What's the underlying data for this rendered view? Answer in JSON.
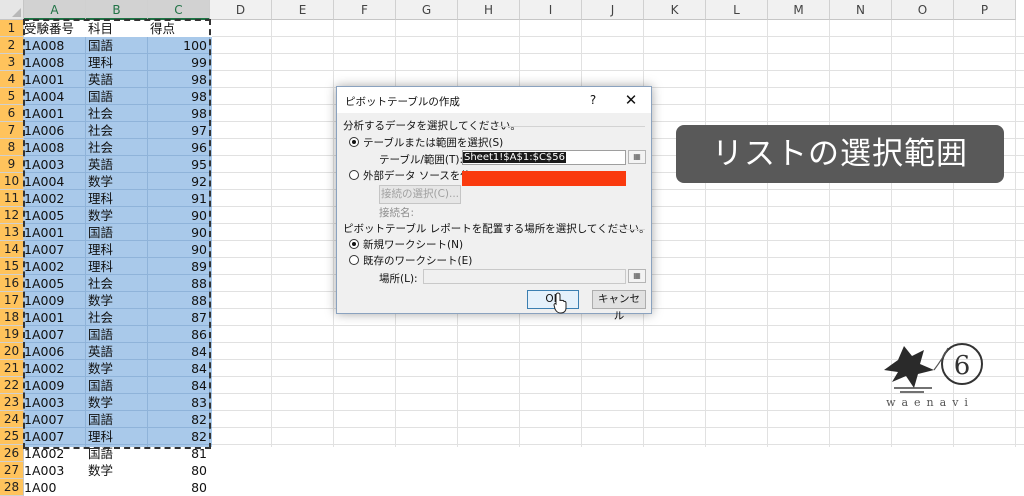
{
  "spreadsheet": {
    "columns": [
      "A",
      "B",
      "C",
      "D",
      "E",
      "F",
      "G",
      "H",
      "I",
      "J",
      "K",
      "L",
      "M",
      "N",
      "O",
      "P"
    ],
    "rows": [
      "1",
      "2",
      "3",
      "4",
      "5",
      "6",
      "7",
      "8",
      "9",
      "10",
      "11",
      "12",
      "13",
      "14",
      "15",
      "16",
      "17",
      "18",
      "19",
      "20",
      "21",
      "22",
      "23",
      "24",
      "25",
      "26",
      "27",
      "28"
    ],
    "header": [
      "受験番号",
      "科目",
      "得点"
    ],
    "data": [
      [
        "1A008",
        "国語",
        "100"
      ],
      [
        "1A008",
        "理科",
        "99"
      ],
      [
        "1A001",
        "英語",
        "98"
      ],
      [
        "1A004",
        "国語",
        "98"
      ],
      [
        "1A001",
        "社会",
        "98"
      ],
      [
        "1A006",
        "社会",
        "97"
      ],
      [
        "1A008",
        "社会",
        "96"
      ],
      [
        "1A003",
        "英語",
        "95"
      ],
      [
        "1A004",
        "数学",
        "92"
      ],
      [
        "1A002",
        "理科",
        "91"
      ],
      [
        "1A005",
        "数学",
        "90"
      ],
      [
        "1A001",
        "国語",
        "90"
      ],
      [
        "1A007",
        "理科",
        "90"
      ],
      [
        "1A002",
        "理科",
        "89"
      ],
      [
        "1A005",
        "社会",
        "88"
      ],
      [
        "1A009",
        "数学",
        "88"
      ],
      [
        "1A001",
        "社会",
        "87"
      ],
      [
        "1A007",
        "国語",
        "86"
      ],
      [
        "1A006",
        "英語",
        "84"
      ],
      [
        "1A002",
        "数学",
        "84"
      ],
      [
        "1A009",
        "国語",
        "84"
      ],
      [
        "1A003",
        "数学",
        "83"
      ],
      [
        "1A007",
        "国語",
        "82"
      ],
      [
        "1A007",
        "理科",
        "82"
      ],
      [
        "1A002",
        "国語",
        "81"
      ],
      [
        "1A003",
        "数学",
        "80"
      ]
    ],
    "partial_row": [
      "1A00",
      "",
      "80"
    ]
  },
  "dialog": {
    "title": "ピボットテーブルの作成",
    "help": "?",
    "close": "✕",
    "section1": "分析するデータを選択してください。",
    "option_table": "テーブルまたは範囲を選択(S)",
    "table_range_label": "テーブル/範囲(T):",
    "table_range_value": "Sheet1!$A$1:$C$56",
    "option_external": "外部データ ソースを使用(U)",
    "choose_connection": "接続の選択(C)...",
    "connection_name_label": "接続名:",
    "section2": "ピボットテーブル レポートを配置する場所を選択してください。",
    "option_new_sheet": "新規ワークシート(N)",
    "option_existing_sheet": "既存のワークシート(E)",
    "location_label": "場所(L):",
    "ok": "OK",
    "cancel": "キャンセル"
  },
  "callout": {
    "text": "リストの選択範囲"
  },
  "brand": {
    "text": "waenavi",
    "mark": "6"
  },
  "colors": {
    "selection": "#a9c9ea",
    "selected_header": "#ffc35c",
    "callout_bg": "#595959",
    "redaction": "#fa3a0e"
  }
}
